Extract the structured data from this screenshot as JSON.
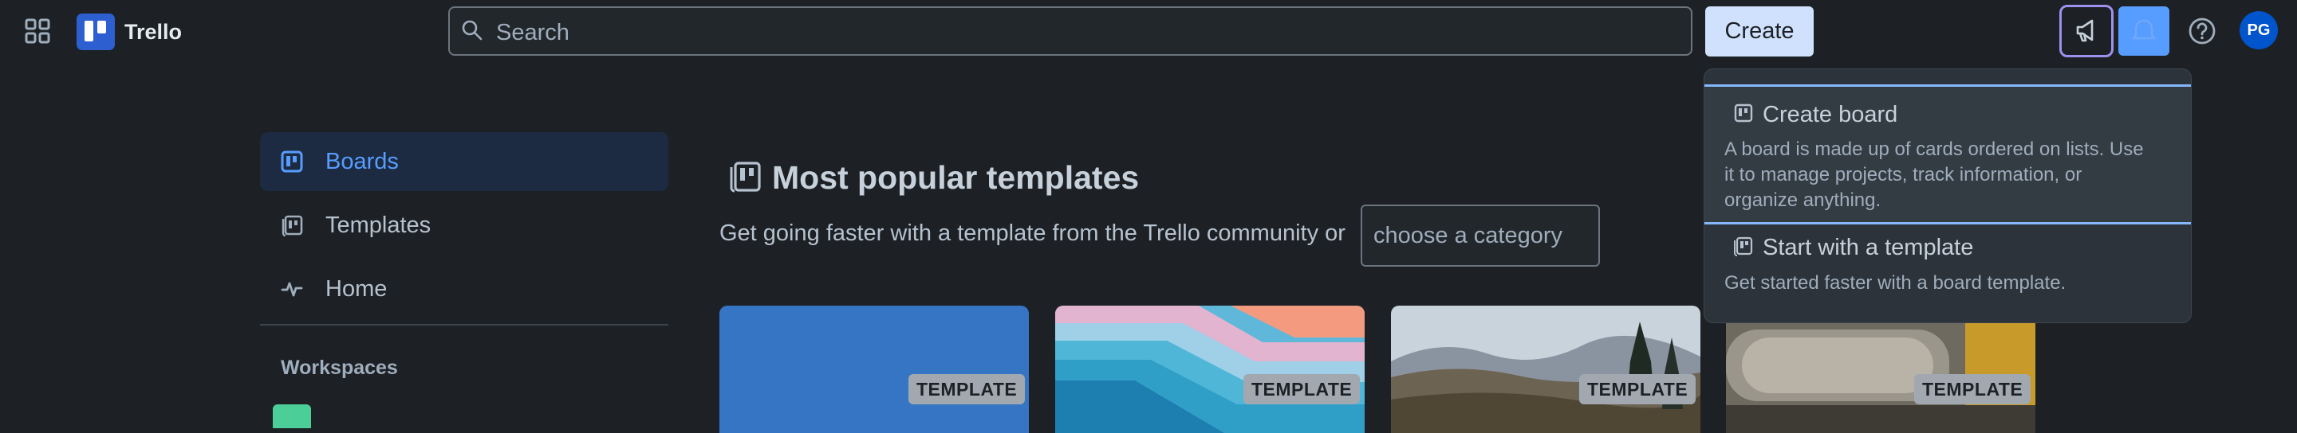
{
  "topbar": {
    "app_name": "Trello",
    "search_placeholder": "Search",
    "create_label": "Create",
    "avatar_initials": "PG",
    "icons": [
      "apps-grid-icon",
      "trello-logo-icon",
      "search-icon",
      "megaphone-icon",
      "bell-icon",
      "help-icon"
    ]
  },
  "sidebar": {
    "items": [
      {
        "label": "Boards",
        "icon": "board-icon",
        "active": true
      },
      {
        "label": "Templates",
        "icon": "template-icon",
        "active": false
      },
      {
        "label": "Home",
        "icon": "activity-icon",
        "active": false
      }
    ],
    "workspaces_label": "Workspaces"
  },
  "main": {
    "title": "Most popular templates",
    "subtitle": "Get going faster with a template from the Trello community or",
    "category_placeholder": "choose a category",
    "template_badge": "TEMPLATE",
    "cards": [
      {
        "badge": "TEMPLATE"
      },
      {
        "badge": "TEMPLATE"
      },
      {
        "badge": "TEMPLATE"
      },
      {
        "badge": "TEMPLATE"
      }
    ]
  },
  "create_menu": {
    "items": [
      {
        "title": "Create board",
        "description": "A board is made up of cards ordered on lists. Use it to manage projects, track information, or organize anything.",
        "description_lines": [
          "A board is made up of cards ordered on lists. Use",
          "it to manage projects, track information, or",
          "organize anything."
        ]
      },
      {
        "title": "Start with a template",
        "description": "Get started faster with a board template."
      }
    ]
  },
  "colors": {
    "background": "#1d2125",
    "accent": "#579dff",
    "create_button": "#cfe1fd",
    "focus_ring": "#9f8fef"
  }
}
